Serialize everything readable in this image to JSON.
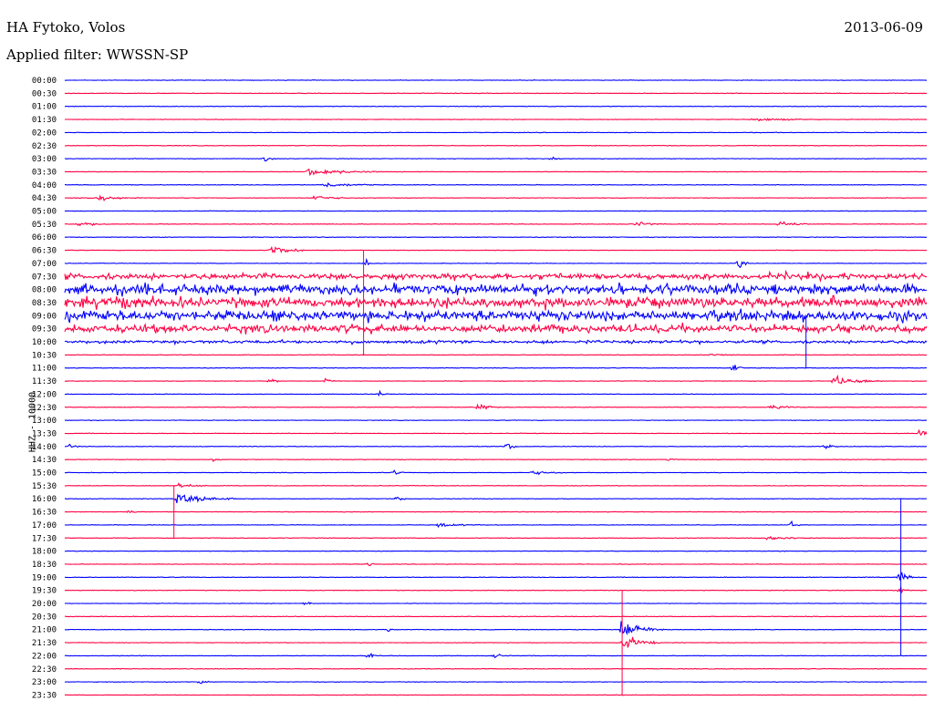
{
  "header": {
    "station": "HA Fytoko, Volos",
    "date": "2013-06-09",
    "filter": "Applied filter: WWSSN-SP"
  },
  "chart_data": {
    "type": "line",
    "title": "HA Fytoko, Volos",
    "ylabel": "HHZ - 10000",
    "rows": [
      "00:00",
      "00:30",
      "01:00",
      "01:30",
      "02:00",
      "02:30",
      "03:00",
      "03:30",
      "04:00",
      "04:30",
      "05:00",
      "05:30",
      "06:00",
      "06:30",
      "07:00",
      "07:30",
      "08:00",
      "08:30",
      "09:00",
      "09:30",
      "10:00",
      "10:30",
      "11:00",
      "11:30",
      "12:00",
      "12:30",
      "13:00",
      "13:30",
      "14:00",
      "14:30",
      "15:00",
      "15:30",
      "16:00",
      "16:30",
      "17:00",
      "17:30",
      "18:00",
      "18:30",
      "19:00",
      "19:30",
      "20:00",
      "20:30",
      "21:00",
      "21:30",
      "22:00",
      "22:30",
      "23:00",
      "23:30"
    ],
    "series_colors": [
      "#0000ff",
      "#ff0044"
    ],
    "row_span_minutes": 30,
    "noisy_rows": [
      {
        "row": 15,
        "amplitude": 0.6
      },
      {
        "row": 16,
        "amplitude": 1.0
      },
      {
        "row": 17,
        "amplitude": 1.0
      },
      {
        "row": 18,
        "amplitude": 1.0
      },
      {
        "row": 19,
        "amplitude": 0.8
      },
      {
        "row": 20,
        "amplitude": 0.3
      }
    ],
    "events": [
      {
        "row": 3,
        "minute": 24,
        "duration": 2.5,
        "amplitude": 0.3
      },
      {
        "row": 6,
        "minute": 7,
        "duration": 0.4,
        "amplitude": 0.6
      },
      {
        "row": 6,
        "minute": 17,
        "duration": 0.4,
        "amplitude": 0.5
      },
      {
        "row": 7,
        "minute": 8.5,
        "duration": 2.5,
        "amplitude": 0.8
      },
      {
        "row": 8,
        "minute": 9,
        "duration": 1.8,
        "amplitude": 0.6
      },
      {
        "row": 9,
        "minute": 1.2,
        "duration": 1.5,
        "amplitude": 0.6
      },
      {
        "row": 9,
        "minute": 8.7,
        "duration": 1.2,
        "amplitude": 0.6
      },
      {
        "row": 11,
        "minute": 0.5,
        "duration": 1.2,
        "amplitude": 0.5
      },
      {
        "row": 11,
        "minute": 19.9,
        "duration": 0.8,
        "amplitude": 0.8
      },
      {
        "row": 11,
        "minute": 24.9,
        "duration": 1,
        "amplitude": 0.8
      },
      {
        "row": 13,
        "minute": 7.2,
        "duration": 1.2,
        "amplitude": 1.3
      },
      {
        "row": 14,
        "minute": 10.5,
        "duration": 0.3,
        "amplitude": 1.2
      },
      {
        "row": 14,
        "minute": 23.5,
        "duration": 0.3,
        "amplitude": 1.3
      },
      {
        "row": 21,
        "minute": 22.5,
        "duration": 1,
        "amplitude": 0.3
      },
      {
        "row": 22,
        "minute": 23.3,
        "duration": 0.3,
        "amplitude": 1.5
      },
      {
        "row": 23,
        "minute": 7.2,
        "duration": 0.3,
        "amplitude": 0.6
      },
      {
        "row": 23,
        "minute": 9.1,
        "duration": 0.3,
        "amplitude": 0.7
      },
      {
        "row": 23,
        "minute": 26.8,
        "duration": 1.8,
        "amplitude": 1.0
      },
      {
        "row": 24,
        "minute": 11,
        "duration": 0.3,
        "amplitude": 0.7
      },
      {
        "row": 25,
        "minute": 14.4,
        "duration": 0.7,
        "amplitude": 1.0
      },
      {
        "row": 25,
        "minute": 24.6,
        "duration": 1.2,
        "amplitude": 0.5
      },
      {
        "row": 27,
        "minute": 29.8,
        "duration": 0.5,
        "amplitude": 1.0
      },
      {
        "row": 28,
        "minute": 0.2,
        "duration": 0.4,
        "amplitude": 0.5
      },
      {
        "row": 28,
        "minute": 15.4,
        "duration": 0.5,
        "amplitude": 0.8
      },
      {
        "row": 28,
        "minute": 26.5,
        "duration": 0.4,
        "amplitude": 0.6
      },
      {
        "row": 29,
        "minute": 5.2,
        "duration": 0.3,
        "amplitude": 0.5
      },
      {
        "row": 29,
        "minute": 21.1,
        "duration": 0.3,
        "amplitude": 0.5
      },
      {
        "row": 30,
        "minute": 11.5,
        "duration": 0.4,
        "amplitude": 0.6
      },
      {
        "row": 30,
        "minute": 16.3,
        "duration": 1.3,
        "amplitude": 0.4
      },
      {
        "row": 31,
        "minute": 4,
        "duration": 1,
        "amplitude": 0.5
      },
      {
        "row": 32,
        "minute": 3.9,
        "duration": 2.2,
        "amplitude": 1.1
      },
      {
        "row": 32,
        "minute": 11.6,
        "duration": 0.3,
        "amplitude": 0.5
      },
      {
        "row": 33,
        "minute": 2.2,
        "duration": 0.4,
        "amplitude": 0.5
      },
      {
        "row": 34,
        "minute": 13,
        "duration": 1.6,
        "amplitude": 0.4
      },
      {
        "row": 34,
        "minute": 25.3,
        "duration": 0.3,
        "amplitude": 0.8
      },
      {
        "row": 35,
        "minute": 24.5,
        "duration": 1.5,
        "amplitude": 0.5
      },
      {
        "row": 37,
        "minute": 10.6,
        "duration": 0.3,
        "amplitude": 0.5
      },
      {
        "row": 38,
        "minute": 29.1,
        "duration": 0.4,
        "amplitude": 2.0
      },
      {
        "row": 39,
        "minute": 29.1,
        "duration": 0.3,
        "amplitude": 1.2
      },
      {
        "row": 40,
        "minute": 8.4,
        "duration": 0.3,
        "amplitude": 0.5
      },
      {
        "row": 42,
        "minute": 11.3,
        "duration": 0.4,
        "amplitude": 0.5
      },
      {
        "row": 42,
        "minute": 19.4,
        "duration": 1.5,
        "amplitude": 2.2
      },
      {
        "row": 43,
        "minute": 19.5,
        "duration": 1.2,
        "amplitude": 1.6
      },
      {
        "row": 44,
        "minute": 10.6,
        "duration": 0.3,
        "amplitude": 0.7
      },
      {
        "row": 44,
        "minute": 15,
        "duration": 0.6,
        "amplitude": 0.4
      },
      {
        "row": 46,
        "minute": 4.7,
        "duration": 0.3,
        "amplitude": 0.6
      }
    ],
    "vertical_spikes": [
      {
        "minute": 25.8,
        "from_row": 18,
        "to_row": 22
      },
      {
        "minute": 29.1,
        "from_row": 32,
        "to_row": 44
      },
      {
        "minute": 19.4,
        "from_row": 39,
        "to_row": 47
      },
      {
        "minute": 10.4,
        "from_row": 13,
        "to_row": 21
      },
      {
        "minute": 3.8,
        "from_row": 31,
        "to_row": 35
      }
    ]
  }
}
